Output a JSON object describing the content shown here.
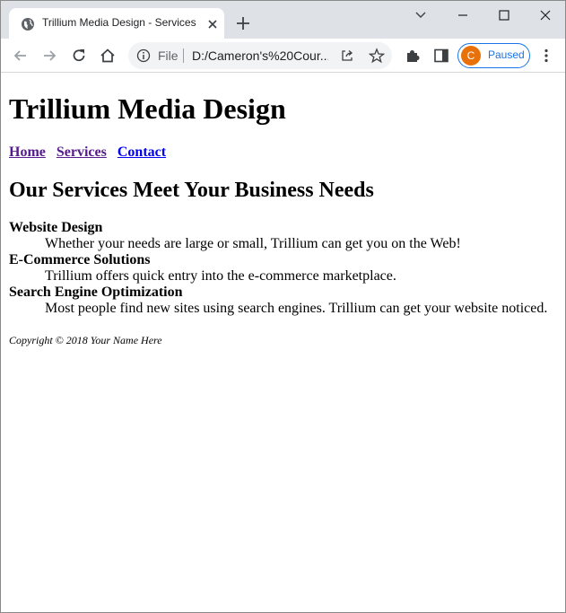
{
  "browser": {
    "tab_title": "Trillium Media Design - Services",
    "omnibox": {
      "scheme_label": "File",
      "url": "D:/Cameron's%20Cour..."
    },
    "profile": {
      "initial": "C",
      "status": "Paused"
    },
    "accent_color": "#1a73e8",
    "avatar_color": "#e8710a"
  },
  "page": {
    "heading": "Trillium Media Design",
    "nav": [
      {
        "label": "Home"
      },
      {
        "label": "Services"
      },
      {
        "label": "Contact"
      }
    ],
    "subheading": "Our Services Meet Your Business Needs",
    "services": [
      {
        "term": "Website Design",
        "desc": "Whether your needs are large or small, Trillium can get you on the Web!"
      },
      {
        "term": "E-Commerce Solutions",
        "desc": "Trillium offers quick entry into the e-commerce marketplace."
      },
      {
        "term": "Search Engine Optimization",
        "desc": "Most people find new sites using search engines. Trillium can get your website noticed."
      }
    ],
    "footer": "Copyright © 2018 Your Name Here"
  }
}
